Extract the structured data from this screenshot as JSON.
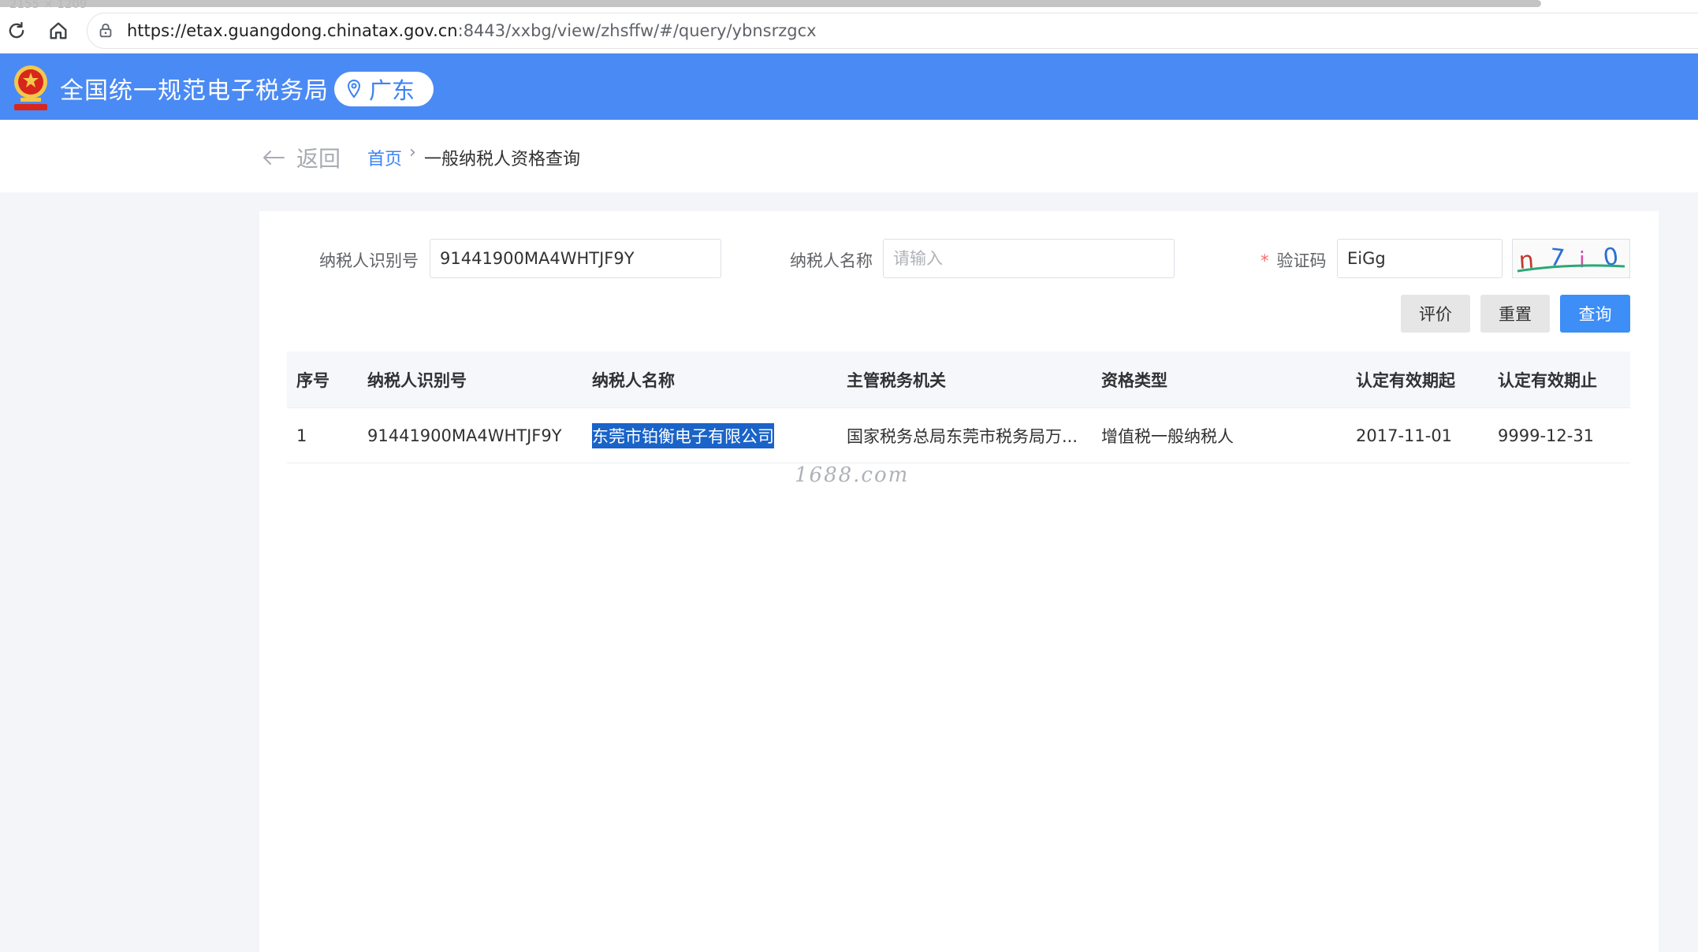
{
  "browser": {
    "screen_size_text": "2155 × 1209",
    "url_host": "https://etax.guangdong.chinatax.gov.cn",
    "url_rest": ":8443/xxbg/view/zhsffw/#/query/ybnsrzgcx"
  },
  "header": {
    "site_title": "全国统一规范电子税务局",
    "region": "广东"
  },
  "breadcrumb": {
    "back_label": "返回",
    "home": "首页",
    "separator": "›",
    "current": "一般纳税人资格查询"
  },
  "form": {
    "taxpayer_id_label": "纳税人识别号",
    "taxpayer_id_value": "91441900MA4WHTJF9Y",
    "taxpayer_name_label": "纳税人名称",
    "taxpayer_name_placeholder": "请输入",
    "captcha_required_mark": "*",
    "captcha_label": "验证码",
    "captcha_value": "EiGg",
    "captcha_image_text": "n7i0"
  },
  "buttons": {
    "evaluate": "评价",
    "reset": "重置",
    "query": "查询"
  },
  "table": {
    "headers": [
      "序号",
      "纳税人识别号",
      "纳税人名称",
      "主管税务机关",
      "资格类型",
      "认定有效期起",
      "认定有效期止"
    ],
    "rows": [
      [
        "1",
        "91441900MA4WHTJF9Y",
        "东莞市铂衡电子有限公司",
        "国家税务总局东莞市税务局万...",
        "增值税一般纳税人",
        "2017-11-01",
        "9999-12-31"
      ]
    ]
  },
  "watermark": "1688.com",
  "colors": {
    "header_blue": "#4a8af4",
    "primary_button": "#3d8ef7",
    "link_blue": "#3b82f6",
    "selection": "#1a63c8"
  }
}
